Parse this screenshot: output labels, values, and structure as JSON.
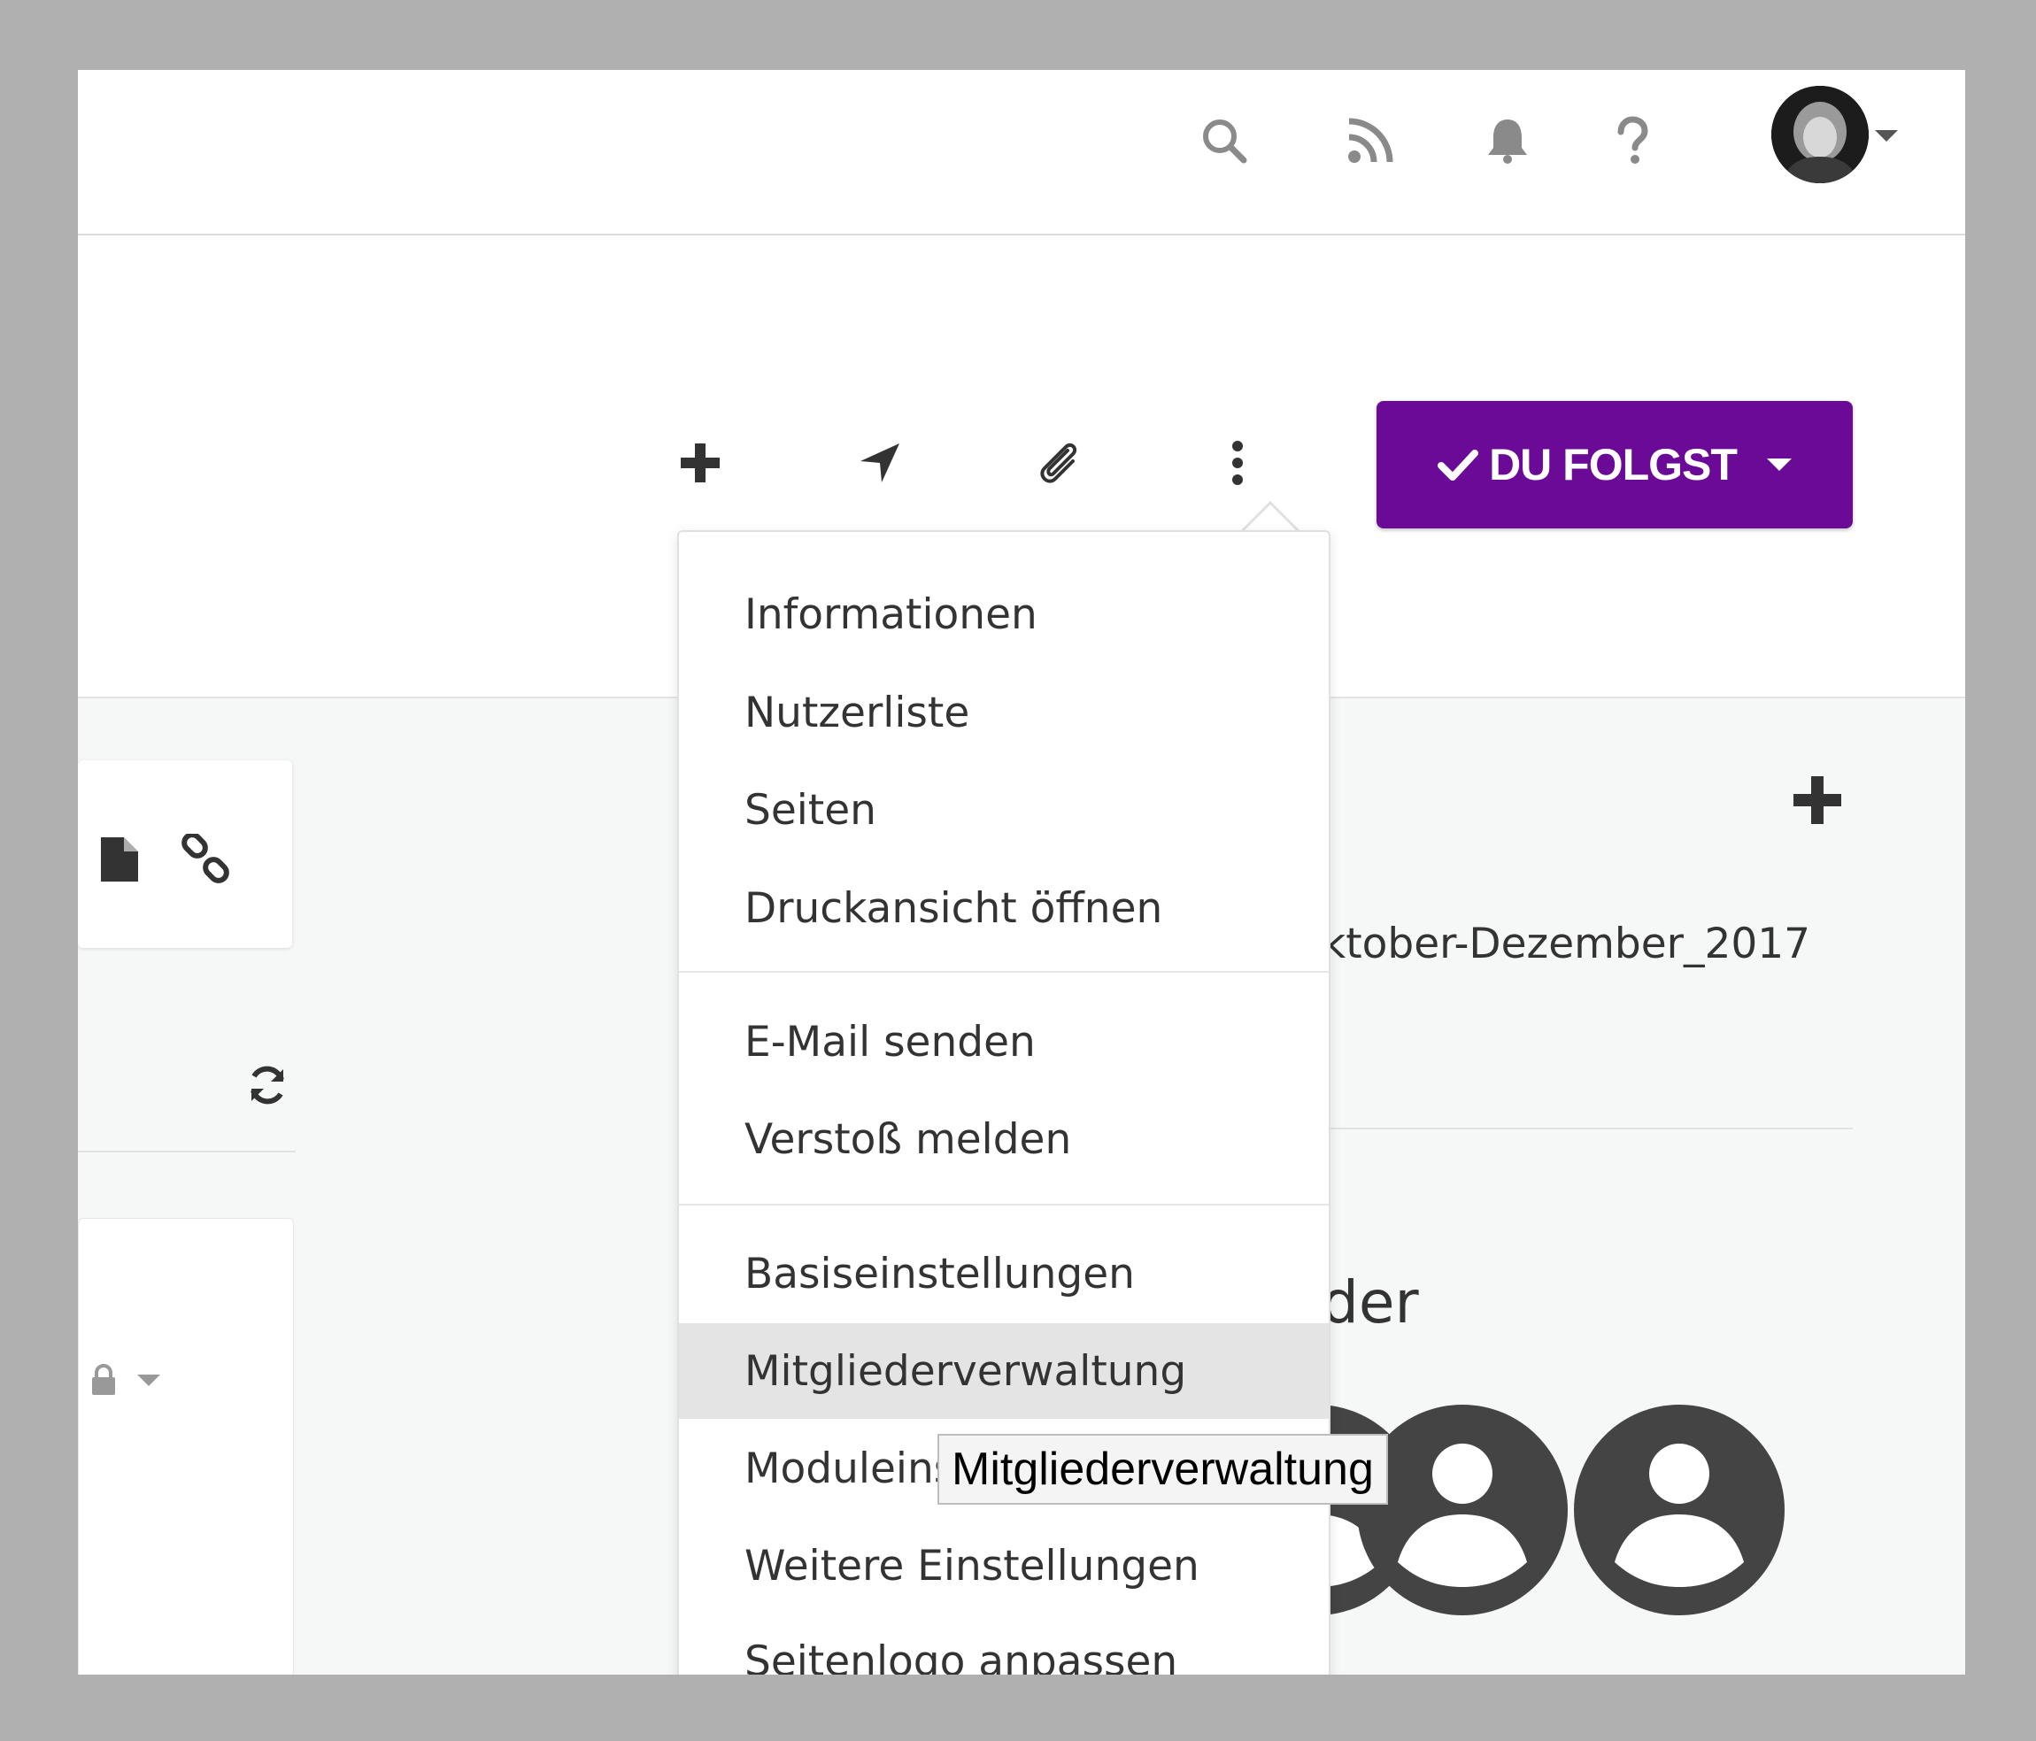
{
  "topbar": {
    "icons": [
      "search-icon",
      "rss-icon",
      "bell-icon",
      "help-icon"
    ],
    "avatar_alt": "user-avatar"
  },
  "actions": {
    "icons": [
      "plus-icon",
      "location-arrow-icon",
      "paperclip-icon",
      "more-vertical-icon"
    ]
  },
  "follow_button": {
    "label": "DU FOLGST",
    "color": "#6a0a96"
  },
  "content": {
    "file_name": "ktober-Dezember_2017",
    "members_heading": "der"
  },
  "dropdown": {
    "groups": [
      [
        "Informationen",
        "Nutzerliste",
        "Seiten",
        "Druckansicht öffnen"
      ],
      [
        "E-Mail senden",
        "Verstoß melden"
      ],
      [
        "Basiseinstellungen",
        "Mitgliederverwaltung",
        "Moduleins",
        "Weitere Einstellungen",
        "Seitenlogo anpassen"
      ]
    ],
    "hovered": "Mitgliederverwaltung"
  },
  "tooltip": {
    "text": "Mitgliederverwaltung"
  }
}
